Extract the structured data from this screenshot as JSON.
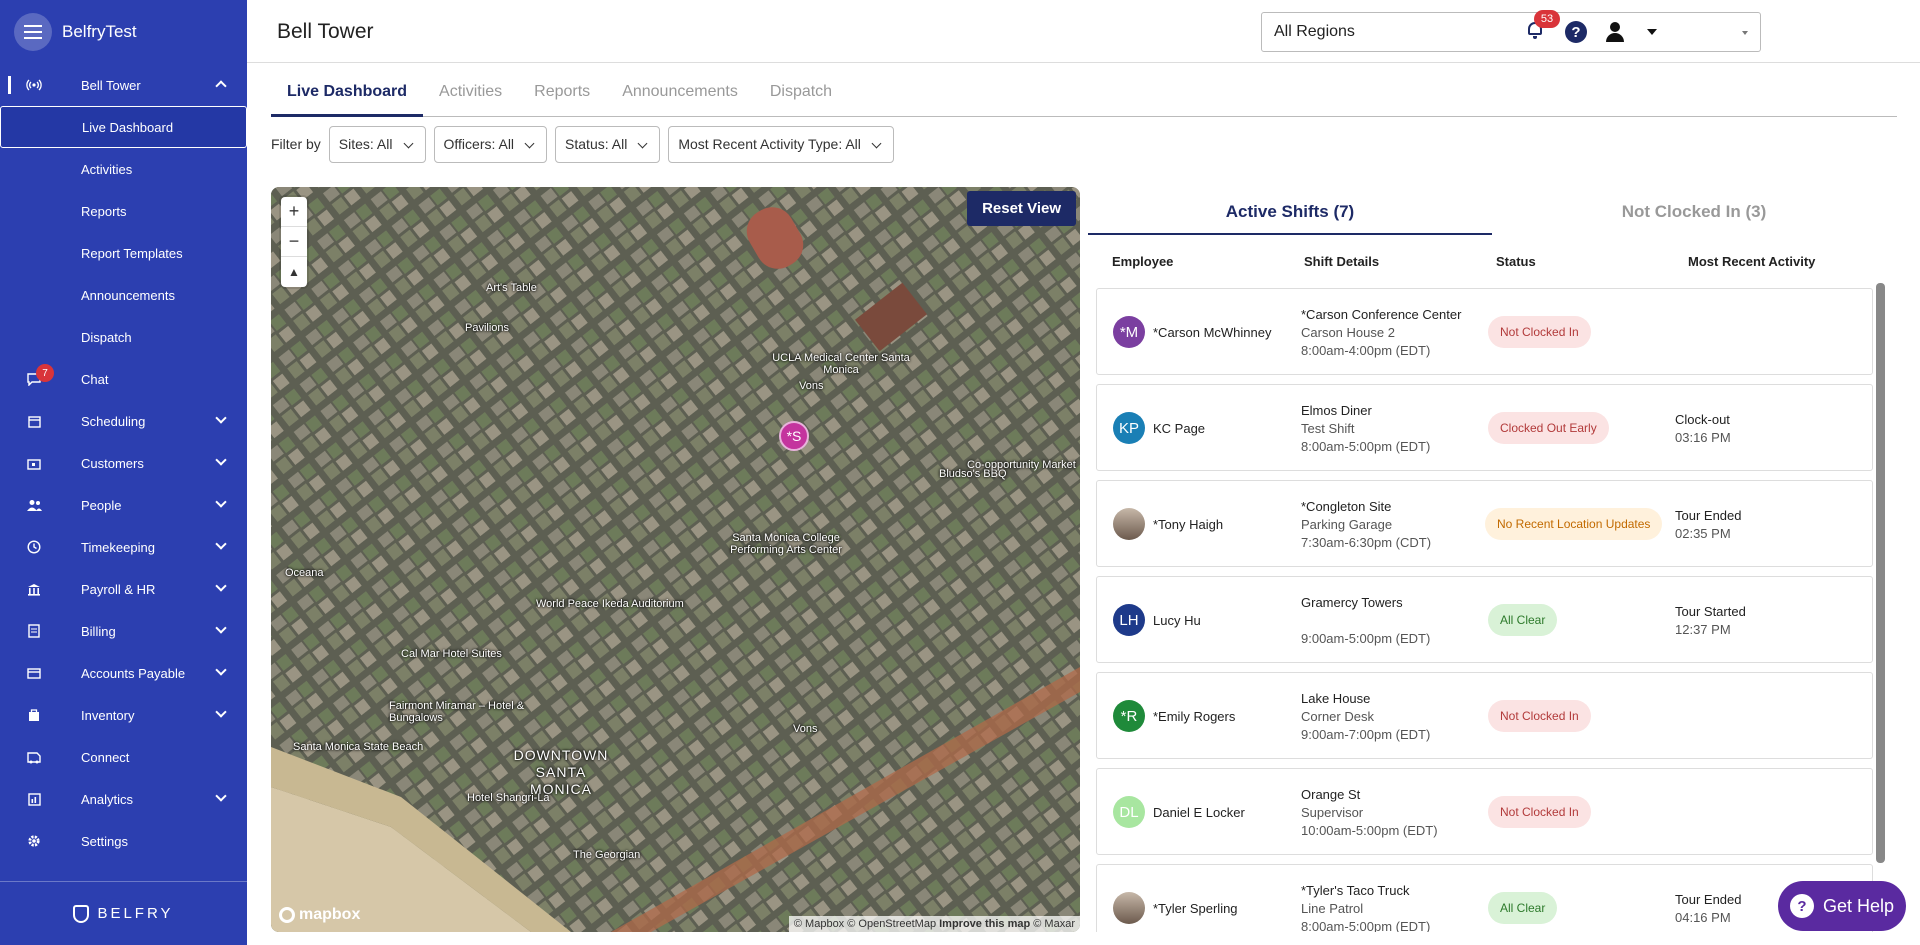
{
  "app": {
    "brand": "BelfryTest",
    "footer_brand": "BELFRY"
  },
  "sidebar": {
    "parent": {
      "label": "Bell Tower"
    },
    "sub_items": [
      {
        "label": "Live Dashboard",
        "selected": true
      },
      {
        "label": "Activities"
      },
      {
        "label": "Reports"
      },
      {
        "label": "Report Templates"
      },
      {
        "label": "Announcements"
      },
      {
        "label": "Dispatch"
      }
    ],
    "items": [
      {
        "label": "Chat",
        "badge": "7",
        "icon": "chat-icon"
      },
      {
        "label": "Scheduling",
        "icon": "calendar-icon",
        "expandable": true
      },
      {
        "label": "Customers",
        "icon": "building-icon",
        "expandable": true
      },
      {
        "label": "People",
        "icon": "people-icon",
        "expandable": true
      },
      {
        "label": "Timekeeping",
        "icon": "clock-icon",
        "expandable": true
      },
      {
        "label": "Payroll & HR",
        "icon": "bank-icon",
        "expandable": true
      },
      {
        "label": "Billing",
        "icon": "billing-icon",
        "expandable": true
      },
      {
        "label": "Accounts Payable",
        "icon": "card-icon",
        "expandable": true
      },
      {
        "label": "Inventory",
        "icon": "inventory-icon",
        "expandable": true
      },
      {
        "label": "Connect",
        "icon": "connect-icon",
        "expandable": false
      },
      {
        "label": "Analytics",
        "icon": "analytics-icon",
        "expandable": true
      },
      {
        "label": "Settings",
        "icon": "gear-icon",
        "expandable": false
      }
    ]
  },
  "header": {
    "title": "Bell Tower",
    "region": "All Regions",
    "notifications": "53"
  },
  "tabs": [
    {
      "label": "Live Dashboard",
      "active": true
    },
    {
      "label": "Activities"
    },
    {
      "label": "Reports"
    },
    {
      "label": "Announcements"
    },
    {
      "label": "Dispatch"
    }
  ],
  "filters": {
    "label": "Filter by",
    "sites": "Sites: All",
    "officers": "Officers: All",
    "status": "Status: All",
    "activity": "Most Recent Activity Type: All"
  },
  "map": {
    "reset": "Reset View",
    "zoom_in": "+",
    "zoom_out": "−",
    "logo": "mapbox",
    "attribution_1": "© Mapbox © OpenStreetMap",
    "attribution_2": "Improve this map",
    "attribution_3": "© Maxar",
    "marker": "*S",
    "labels": [
      "UCLA Medical Center Santa Monica",
      "Santa Monica College Performing Arts Center",
      "Art's Table",
      "Pavilions",
      "Vons",
      "Bludso's BBQ",
      "Co-opportunity Market",
      "World Peace Ikeda Auditorium",
      "Cal Mar Hotel Suites",
      "Fairmont Miramar – Hotel & Bungalows",
      "Santa Monica State Beach",
      "DOWNTOWN SANTA MONICA",
      "Hotel Shangri-La",
      "The Georgian",
      "Oceana",
      "Vons"
    ]
  },
  "shifts": {
    "tab_active": "Active Shifts (7)",
    "tab_inactive": "Not Clocked In (3)",
    "columns": [
      "Employee",
      "Shift Details",
      "Status",
      "Most Recent Activity"
    ],
    "rows": [
      {
        "initials": "*M",
        "color": "#7b3fa0",
        "name": "*Carson McWhinney",
        "site": "*Carson Conference Center",
        "post": "Carson House 2",
        "time": "8:00am-4:00pm (EDT)",
        "status": "Not Clocked In",
        "status_type": "red",
        "activity": "",
        "activity_time": ""
      },
      {
        "initials": "KP",
        "color": "#1a7fb5",
        "name": "KC Page",
        "site": "Elmos Diner",
        "post": "Test Shift",
        "time": "8:00am-5:00pm (EDT)",
        "status": "Clocked Out Early",
        "status_type": "red",
        "activity": "Clock-out",
        "activity_time": "03:16 PM"
      },
      {
        "initials": "",
        "color": "photo",
        "name": "*Tony Haigh",
        "site": "*Congleton Site",
        "post": "Parking Garage",
        "time": "7:30am-6:30pm (CDT)",
        "status": "No Recent Location Updates",
        "status_type": "orange",
        "activity": "Tour Ended",
        "activity_time": "02:35 PM"
      },
      {
        "initials": "LH",
        "color": "#1e3a8a",
        "name": "Lucy Hu",
        "site": "Gramercy Towers",
        "post": "",
        "time": "9:00am-5:00pm (EDT)",
        "status": "All Clear",
        "status_type": "green",
        "activity": "Tour Started",
        "activity_time": "12:37 PM"
      },
      {
        "initials": "*R",
        "color": "#1f8a3a",
        "name": "*Emily Rogers",
        "site": "Lake House",
        "post": "Corner Desk",
        "time": "9:00am-7:00pm (EDT)",
        "status": "Not Clocked In",
        "status_type": "red",
        "activity": "",
        "activity_time": ""
      },
      {
        "initials": "DL",
        "color": "#a8e6a0",
        "name": "Daniel E Locker",
        "site": "Orange St",
        "post": "Supervisor",
        "time": "10:00am-5:00pm (EDT)",
        "status": "Not Clocked In",
        "status_type": "red",
        "activity": "",
        "activity_time": ""
      },
      {
        "initials": "",
        "color": "photo",
        "name": "*Tyler Sperling",
        "site": "*Tyler's Taco Truck",
        "post": "Line Patrol",
        "time": "8:00am-5:00pm (EDT)",
        "status": "All Clear",
        "status_type": "green",
        "activity": "Tour Ended",
        "activity_time": "04:16 PM"
      }
    ]
  },
  "help": {
    "label": "Get Help"
  }
}
